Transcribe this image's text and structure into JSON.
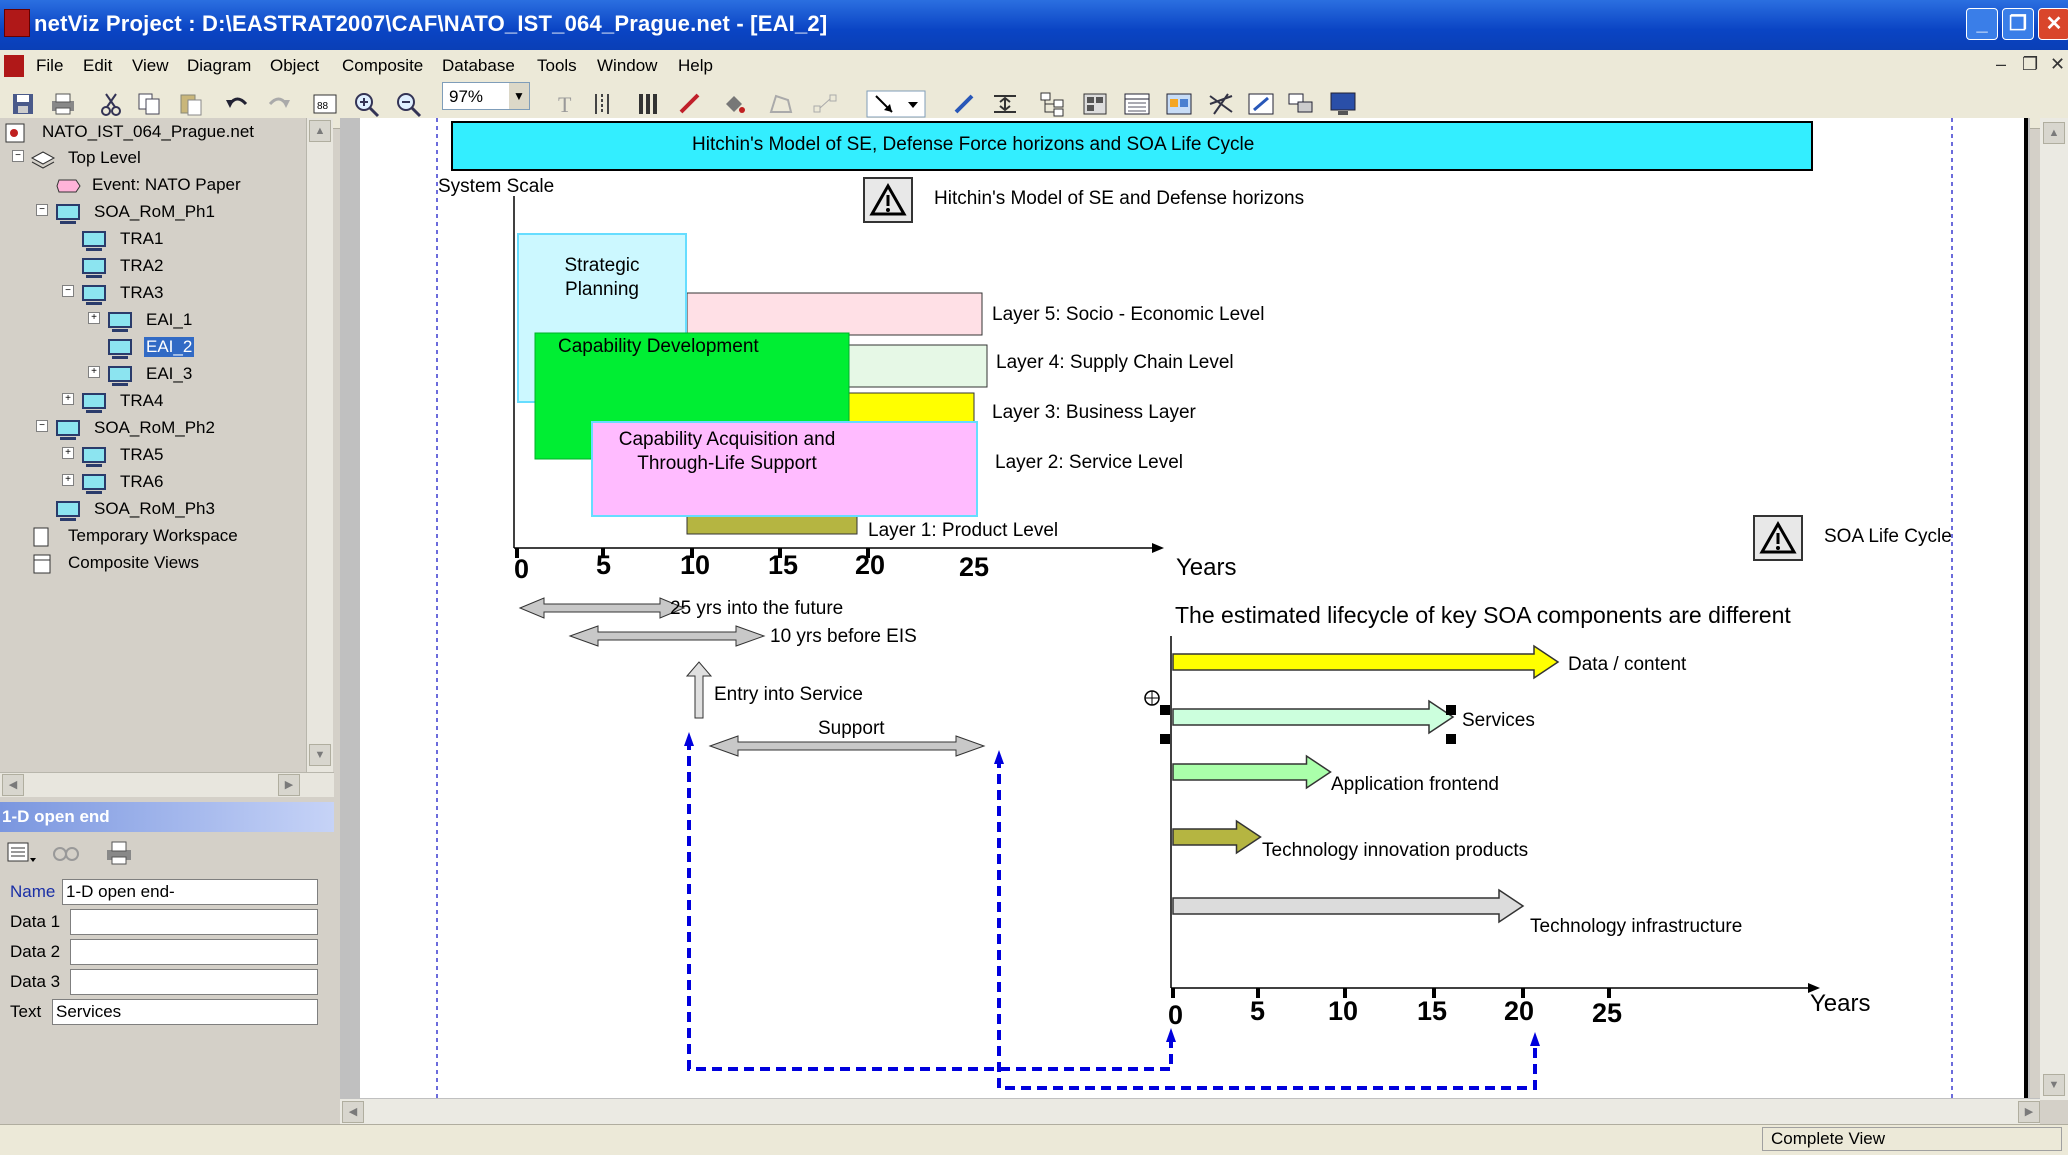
{
  "window": {
    "title": "netViz Project : D:\\EASTRAT2007\\CAF\\NATO_IST_064_Prague.net - [EAI_2]",
    "controls": [
      "_",
      "❐",
      "✕"
    ]
  },
  "menu": [
    "File",
    "Edit",
    "View",
    "Diagram",
    "Object",
    "Composite",
    "Database",
    "Tools",
    "Window",
    "Help"
  ],
  "toolbar": {
    "zoom": "97%"
  },
  "tree": {
    "root": "NATO_IST_064_Prague.net",
    "items": [
      {
        "label": "Top Level"
      },
      {
        "label": "Event: NATO Paper"
      },
      {
        "label": "SOA_RoM_Ph1"
      },
      {
        "label": "TRA1"
      },
      {
        "label": "TRA2"
      },
      {
        "label": "TRA3"
      },
      {
        "label": "EAI_1"
      },
      {
        "label": "EAI_2"
      },
      {
        "label": "EAI_3"
      },
      {
        "label": "TRA4"
      },
      {
        "label": "SOA_RoM_Ph2"
      },
      {
        "label": "TRA5"
      },
      {
        "label": "TRA6"
      },
      {
        "label": "SOA_RoM_Ph3"
      },
      {
        "label": "Temporary Workspace"
      },
      {
        "label": "Composite Views"
      }
    ]
  },
  "properties": {
    "header": "1-D open end",
    "name_label": "Name",
    "name_value": "1-D open end-",
    "data1_label": "Data 1",
    "data2_label": "Data 2",
    "data3_label": "Data 3",
    "text_label": "Text",
    "text_value": "Services"
  },
  "diagram": {
    "banner": "Hitchin's Model of SE, Defense Force horizons and SOA Life Cycle",
    "hitchin_title": "Hitchin's Model of SE and Defense horizons",
    "system_scale": "System Scale",
    "strategic_planning": "Strategic\nPlanning",
    "capability_development": "Capability Development",
    "capability_acquisition": "Capability Acquisition and\nThrough-Life Support",
    "layers": [
      "Layer 5: Socio - Economic Level",
      "Layer 4: Supply Chain Level",
      "Layer 3: Business Layer",
      "Layer 2: Service Level",
      "Layer 1: Product Level"
    ],
    "years_label": "Years",
    "x_ticks": [
      "0",
      "5",
      "10",
      "15",
      "20",
      "25"
    ],
    "future_label": "25 yrs into the future",
    "before_eis_label": "10 yrs before EIS",
    "entry_label": "Entry into Service",
    "support_label": "Support",
    "soa_title": "SOA Life Cycle",
    "soa_heading": "The estimated lifecycle of key SOA components are different",
    "soa_components": [
      {
        "label": "Data / content",
        "years": 22,
        "color": "#ffff00"
      },
      {
        "label": "Services",
        "years": 16,
        "color": "#ccffdd"
      },
      {
        "label": "Application frontend",
        "years": 9,
        "color": "#aaffaa"
      },
      {
        "label": "Technology innovation products",
        "years": 5,
        "color": "#b5b541"
      },
      {
        "label": "Technology infrastructure",
        "years": 20,
        "color": "#dcdcdc"
      }
    ],
    "soa_years_label": "Years",
    "soa_ticks": [
      "0",
      "5",
      "10",
      "15",
      "20",
      "25"
    ]
  },
  "status": {
    "view": "Complete View"
  }
}
